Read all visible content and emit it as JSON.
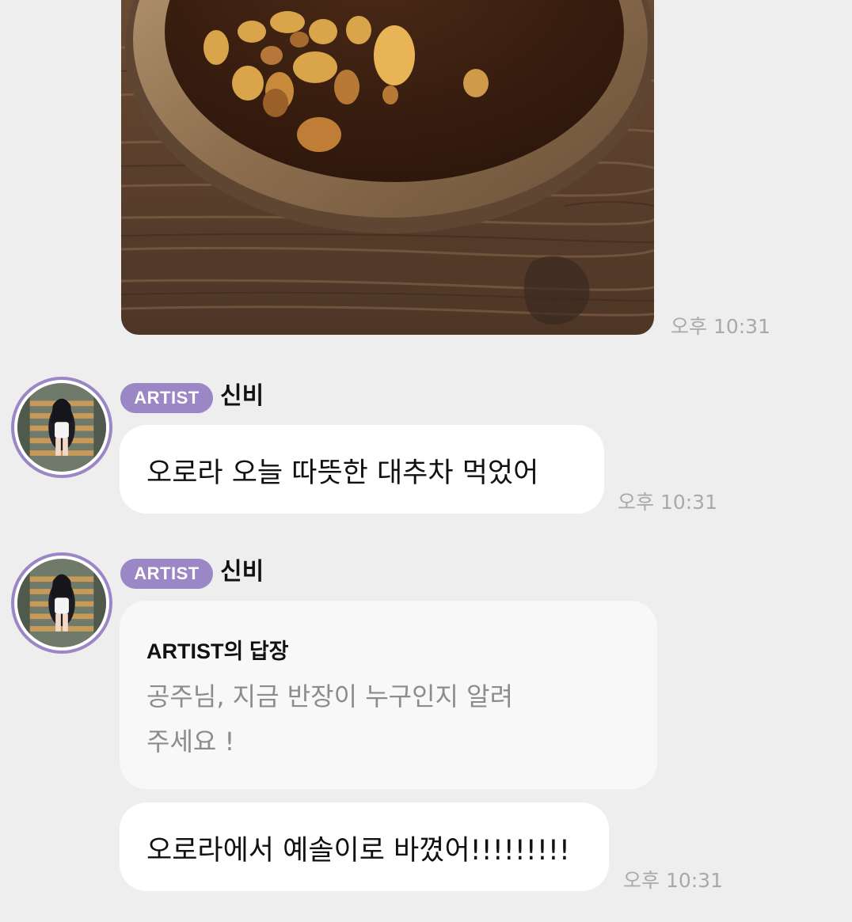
{
  "messages": [
    {
      "type": "image",
      "image_description": "cup of jujube tea with pine nuts on wooden table",
      "time": "오후 10:31"
    },
    {
      "type": "text",
      "badge": "ARTIST",
      "sender": "신비",
      "text": "오로라 오늘 따뜻한 대추차 먹었어",
      "time": "오후 10:31"
    },
    {
      "type": "reply",
      "badge": "ARTIST",
      "sender": "신비",
      "reply_title": "ARTIST의 답장",
      "reply_quote_line1": "공주님, 지금 반장이 누구인지 알려",
      "reply_quote_line2": "주세요 !",
      "text": "오로라에서 예솔이로 바꼈어!!!!!!!!!",
      "time": "오후 10:31"
    }
  ],
  "colors": {
    "background": "#eeeeee",
    "bubble": "#ffffff",
    "reply_bubble": "#f8f8f8",
    "accent": "#9b86c6",
    "timestamp": "#a9a9a9",
    "quote_text": "#8c8c8c"
  }
}
